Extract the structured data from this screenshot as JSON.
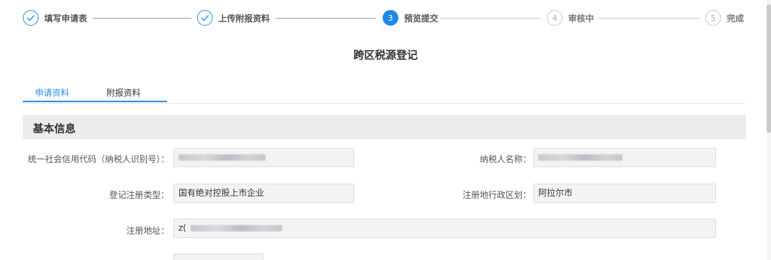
{
  "steps": [
    {
      "number": "",
      "label": "填写申请表",
      "state": "done"
    },
    {
      "number": "",
      "label": "上传附报资料",
      "state": "done"
    },
    {
      "number": "3",
      "label": "预览提交",
      "state": "active"
    },
    {
      "number": "4",
      "label": "审核中",
      "state": "pending"
    },
    {
      "number": "5",
      "label": "完成",
      "state": "pending"
    }
  ],
  "page_title": "跨区税源登记",
  "tabs": [
    {
      "label": "申请资料",
      "active": true
    },
    {
      "label": "附报资料",
      "active": false
    }
  ],
  "section": {
    "title": "基本信息"
  },
  "form": {
    "credit_code": {
      "label": "统一社会信用代码（纳税人识别号）：",
      "value": ""
    },
    "taxpayer_name": {
      "label": "纳税人名称：",
      "value": ""
    },
    "registration_type": {
      "label": "登记注册类型：",
      "value": "国有绝对控股上市企业"
    },
    "registration_region": {
      "label": "注册地行政区划：",
      "value": "阿拉尔市"
    },
    "registration_address": {
      "label": "注册地址：",
      "value": "z("
    }
  },
  "colors": {
    "accent": "#2b8de3",
    "section_bg": "#ececec",
    "field_bg": "#f3f3f3"
  },
  "icons": {
    "done_step": "check-icon"
  }
}
